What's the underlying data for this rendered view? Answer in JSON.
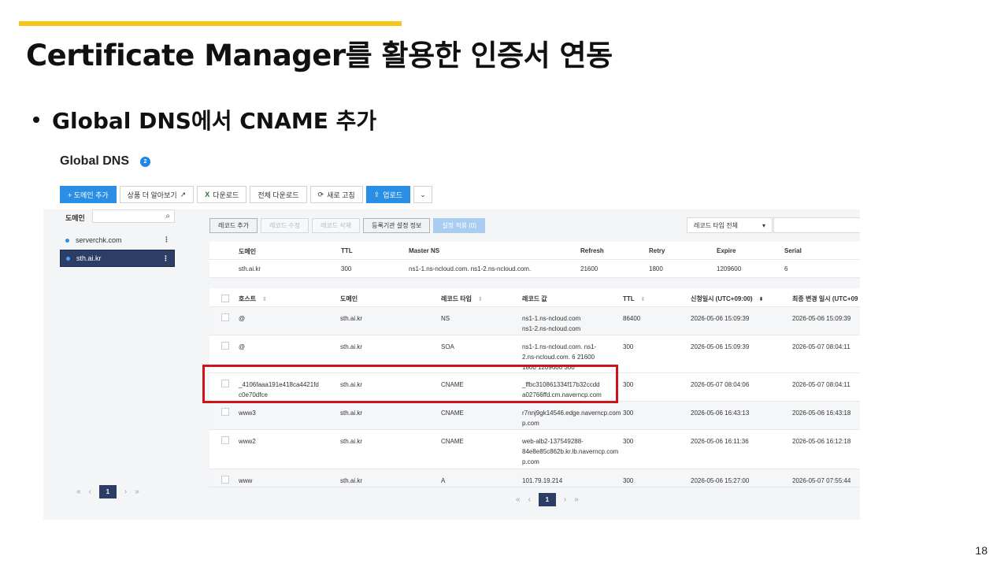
{
  "slide": {
    "title": "Certificate Manager를 활용한 인증서 연동",
    "bullet": "Global DNS에서 CNAME 추가",
    "page_number": "18",
    "accent_color": "#f5c518"
  },
  "console": {
    "title": "Global DNS",
    "badge": "2",
    "toolbar": {
      "add_domain": "+ 도메인 추가",
      "product_more": "상품 더 알아보기",
      "download": "다운로드",
      "download_all": "전체 다운로드",
      "refresh": "새로 고침",
      "upload": "업로드"
    },
    "left": {
      "domain_label": "도메인",
      "search_placeholder": "",
      "domains": [
        "serverchk.com",
        "sth.ai.kr"
      ],
      "active_domain": "sth.ai.kr",
      "page": "1"
    },
    "record_toolbar": {
      "add": "레코드 추가",
      "edit": "레코드 수정",
      "delete": "레코드 삭제",
      "registrar": "등록기관 설정 정보",
      "apply": "설정 적용 (0)",
      "type_filter": "레코드 타입 전체"
    },
    "soa": {
      "headers": {
        "domain": "도메인",
        "ttl": "TTL",
        "master": "Master NS",
        "refresh": "Refresh",
        "retry": "Retry",
        "expire": "Expire",
        "serial": "Serial"
      },
      "row": {
        "domain": "sth.ai.kr",
        "ttl": "300",
        "master": "ns1-1.ns-ncloud.com. ns1-2.ns-ncloud.com.",
        "refresh": "21600",
        "retry": "1800",
        "expire": "1209600",
        "serial": "6"
      }
    },
    "records": {
      "headers": {
        "host": "호스트",
        "domain": "도메인",
        "type": "레코드 타입",
        "value": "레코드 값",
        "ttl": "TTL",
        "created": "신청일시 (UTC+09:00)",
        "modified": "최종 변경 일시 (UTC+09"
      },
      "rows": [
        {
          "host": "@",
          "host2": "",
          "domain": "sth.ai.kr",
          "type": "NS",
          "value": "ns1-1.ns-ncloud.com",
          "value2": "ns1-2.ns-ncloud.com",
          "value3": "",
          "ttl": "86400",
          "created": "2026-05-06 15:09:39",
          "modified": "2026-05-06 15:09:39"
        },
        {
          "host": "@",
          "host2": "",
          "domain": "sth.ai.kr",
          "type": "SOA",
          "value": "ns1-1.ns-ncloud.com. ns1-",
          "value2": "2.ns-ncloud.com. 6 21600",
          "value3": "1800 1209600 300",
          "ttl": "300",
          "created": "2026-05-06 15:09:39",
          "modified": "2026-05-07 08:04:11"
        },
        {
          "host": "_4106faaa191e418ca4421fd",
          "host2": "c0e70dfce",
          "domain": "sth.ai.kr",
          "type": "CNAME",
          "value": "_ffbc310861334f17b32ccdd",
          "value2": "a02766ffd.cm.naverncp.com",
          "value3": "",
          "ttl": "300",
          "created": "2026-05-07 08:04:06",
          "modified": "2026-05-07 08:04:11"
        },
        {
          "host": "www3",
          "host2": "",
          "domain": "sth.ai.kr",
          "type": "CNAME",
          "value": "r7nnj9gk14546.edge.naverncp.com",
          "value2": "p.com",
          "value3": "",
          "ttl": "300",
          "created": "2026-05-06 16:43:13",
          "modified": "2026-05-06 16:43:18"
        },
        {
          "host": "www2",
          "host2": "",
          "domain": "sth.ai.kr",
          "type": "CNAME",
          "value": "web-alb2-137549288-",
          "value2": "84e8e85c862b.kr.lb.naverncp.com",
          "value3": "p.com",
          "ttl": "300",
          "created": "2026-05-06 16:11:36",
          "modified": "2026-05-06 16:12:18"
        },
        {
          "host": "www",
          "host2": "",
          "domain": "sth.ai.kr",
          "type": "A",
          "value": "101.79.19.214",
          "value2": "",
          "value3": "",
          "ttl": "300",
          "created": "2026-05-06 15:27:00",
          "modified": "2026-05-07 07:55:44"
        }
      ],
      "page": "1"
    }
  }
}
